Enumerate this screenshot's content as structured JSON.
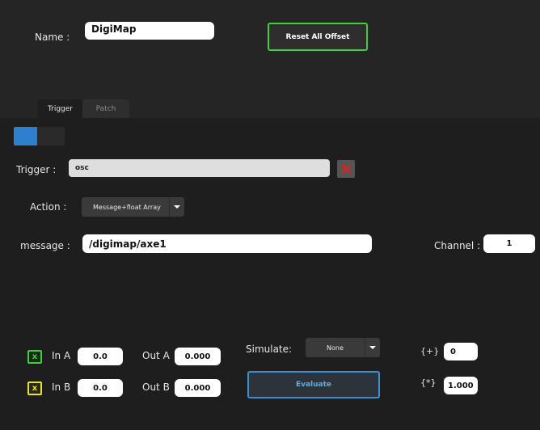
{
  "header": {
    "name_label": "Name :",
    "name_value": "DigiMap",
    "reset_button": "Reset All Offset"
  },
  "tabs": [
    {
      "label": "Trigger",
      "active": true
    },
    {
      "label": "Patch",
      "active": false
    }
  ],
  "toggle": {
    "state": "on"
  },
  "trigger": {
    "label": "Trigger :",
    "value": "osc",
    "delete_icon": "close-icon"
  },
  "action": {
    "label": "Action :",
    "selected": "Message+float Array"
  },
  "message": {
    "label": "message :",
    "value": "/digimap/axe1"
  },
  "channel": {
    "label": "Channel :",
    "value": "1"
  },
  "row_a": {
    "checkbox": "x",
    "in_label": "In A",
    "in_value": "0.0",
    "out_label": "Out A",
    "out_value": "0.000"
  },
  "row_b": {
    "checkbox": "x",
    "in_label": "In B",
    "in_value": "0.0",
    "out_label": "Out B",
    "out_value": "0.000"
  },
  "simulate": {
    "label": "Simulate:",
    "selected": "None"
  },
  "evaluate_button": "Evaluate",
  "offset": {
    "label": "{+}",
    "value": "0"
  },
  "multiplier": {
    "label": "{*}",
    "value": "1.000"
  },
  "colors": {
    "accent_green": "#3ad23a",
    "accent_yellow": "#e5e52a",
    "accent_blue": "#3a8fcf",
    "toggle_blue": "#2f7fd1",
    "delete_red": "#e02020"
  }
}
